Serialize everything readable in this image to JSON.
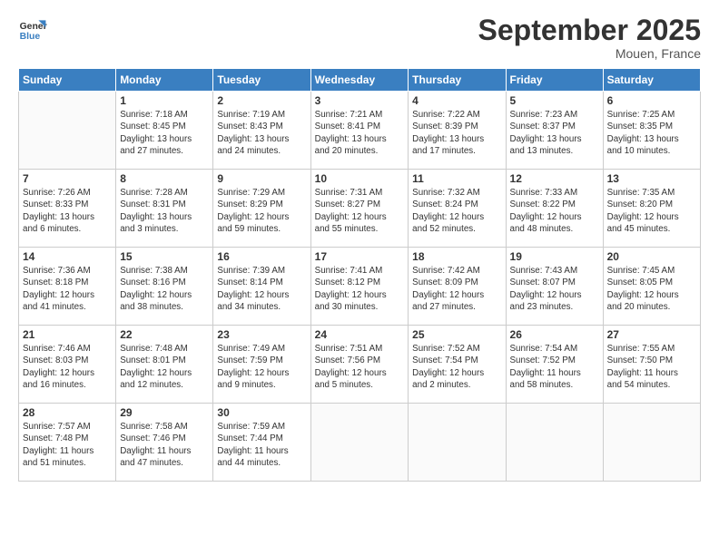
{
  "header": {
    "title": "September 2025",
    "subtitle": "Mouen, France",
    "logo_line1": "General",
    "logo_line2": "Blue"
  },
  "days_of_week": [
    "Sunday",
    "Monday",
    "Tuesday",
    "Wednesday",
    "Thursday",
    "Friday",
    "Saturday"
  ],
  "weeks": [
    [
      {
        "day": "",
        "info": ""
      },
      {
        "day": "1",
        "info": "Sunrise: 7:18 AM\nSunset: 8:45 PM\nDaylight: 13 hours\nand 27 minutes."
      },
      {
        "day": "2",
        "info": "Sunrise: 7:19 AM\nSunset: 8:43 PM\nDaylight: 13 hours\nand 24 minutes."
      },
      {
        "day": "3",
        "info": "Sunrise: 7:21 AM\nSunset: 8:41 PM\nDaylight: 13 hours\nand 20 minutes."
      },
      {
        "day": "4",
        "info": "Sunrise: 7:22 AM\nSunset: 8:39 PM\nDaylight: 13 hours\nand 17 minutes."
      },
      {
        "day": "5",
        "info": "Sunrise: 7:23 AM\nSunset: 8:37 PM\nDaylight: 13 hours\nand 13 minutes."
      },
      {
        "day": "6",
        "info": "Sunrise: 7:25 AM\nSunset: 8:35 PM\nDaylight: 13 hours\nand 10 minutes."
      }
    ],
    [
      {
        "day": "7",
        "info": "Sunrise: 7:26 AM\nSunset: 8:33 PM\nDaylight: 13 hours\nand 6 minutes."
      },
      {
        "day": "8",
        "info": "Sunrise: 7:28 AM\nSunset: 8:31 PM\nDaylight: 13 hours\nand 3 minutes."
      },
      {
        "day": "9",
        "info": "Sunrise: 7:29 AM\nSunset: 8:29 PM\nDaylight: 12 hours\nand 59 minutes."
      },
      {
        "day": "10",
        "info": "Sunrise: 7:31 AM\nSunset: 8:27 PM\nDaylight: 12 hours\nand 55 minutes."
      },
      {
        "day": "11",
        "info": "Sunrise: 7:32 AM\nSunset: 8:24 PM\nDaylight: 12 hours\nand 52 minutes."
      },
      {
        "day": "12",
        "info": "Sunrise: 7:33 AM\nSunset: 8:22 PM\nDaylight: 12 hours\nand 48 minutes."
      },
      {
        "day": "13",
        "info": "Sunrise: 7:35 AM\nSunset: 8:20 PM\nDaylight: 12 hours\nand 45 minutes."
      }
    ],
    [
      {
        "day": "14",
        "info": "Sunrise: 7:36 AM\nSunset: 8:18 PM\nDaylight: 12 hours\nand 41 minutes."
      },
      {
        "day": "15",
        "info": "Sunrise: 7:38 AM\nSunset: 8:16 PM\nDaylight: 12 hours\nand 38 minutes."
      },
      {
        "day": "16",
        "info": "Sunrise: 7:39 AM\nSunset: 8:14 PM\nDaylight: 12 hours\nand 34 minutes."
      },
      {
        "day": "17",
        "info": "Sunrise: 7:41 AM\nSunset: 8:12 PM\nDaylight: 12 hours\nand 30 minutes."
      },
      {
        "day": "18",
        "info": "Sunrise: 7:42 AM\nSunset: 8:09 PM\nDaylight: 12 hours\nand 27 minutes."
      },
      {
        "day": "19",
        "info": "Sunrise: 7:43 AM\nSunset: 8:07 PM\nDaylight: 12 hours\nand 23 minutes."
      },
      {
        "day": "20",
        "info": "Sunrise: 7:45 AM\nSunset: 8:05 PM\nDaylight: 12 hours\nand 20 minutes."
      }
    ],
    [
      {
        "day": "21",
        "info": "Sunrise: 7:46 AM\nSunset: 8:03 PM\nDaylight: 12 hours\nand 16 minutes."
      },
      {
        "day": "22",
        "info": "Sunrise: 7:48 AM\nSunset: 8:01 PM\nDaylight: 12 hours\nand 12 minutes."
      },
      {
        "day": "23",
        "info": "Sunrise: 7:49 AM\nSunset: 7:59 PM\nDaylight: 12 hours\nand 9 minutes."
      },
      {
        "day": "24",
        "info": "Sunrise: 7:51 AM\nSunset: 7:56 PM\nDaylight: 12 hours\nand 5 minutes."
      },
      {
        "day": "25",
        "info": "Sunrise: 7:52 AM\nSunset: 7:54 PM\nDaylight: 12 hours\nand 2 minutes."
      },
      {
        "day": "26",
        "info": "Sunrise: 7:54 AM\nSunset: 7:52 PM\nDaylight: 11 hours\nand 58 minutes."
      },
      {
        "day": "27",
        "info": "Sunrise: 7:55 AM\nSunset: 7:50 PM\nDaylight: 11 hours\nand 54 minutes."
      }
    ],
    [
      {
        "day": "28",
        "info": "Sunrise: 7:57 AM\nSunset: 7:48 PM\nDaylight: 11 hours\nand 51 minutes."
      },
      {
        "day": "29",
        "info": "Sunrise: 7:58 AM\nSunset: 7:46 PM\nDaylight: 11 hours\nand 47 minutes."
      },
      {
        "day": "30",
        "info": "Sunrise: 7:59 AM\nSunset: 7:44 PM\nDaylight: 11 hours\nand 44 minutes."
      },
      {
        "day": "",
        "info": ""
      },
      {
        "day": "",
        "info": ""
      },
      {
        "day": "",
        "info": ""
      },
      {
        "day": "",
        "info": ""
      }
    ]
  ]
}
